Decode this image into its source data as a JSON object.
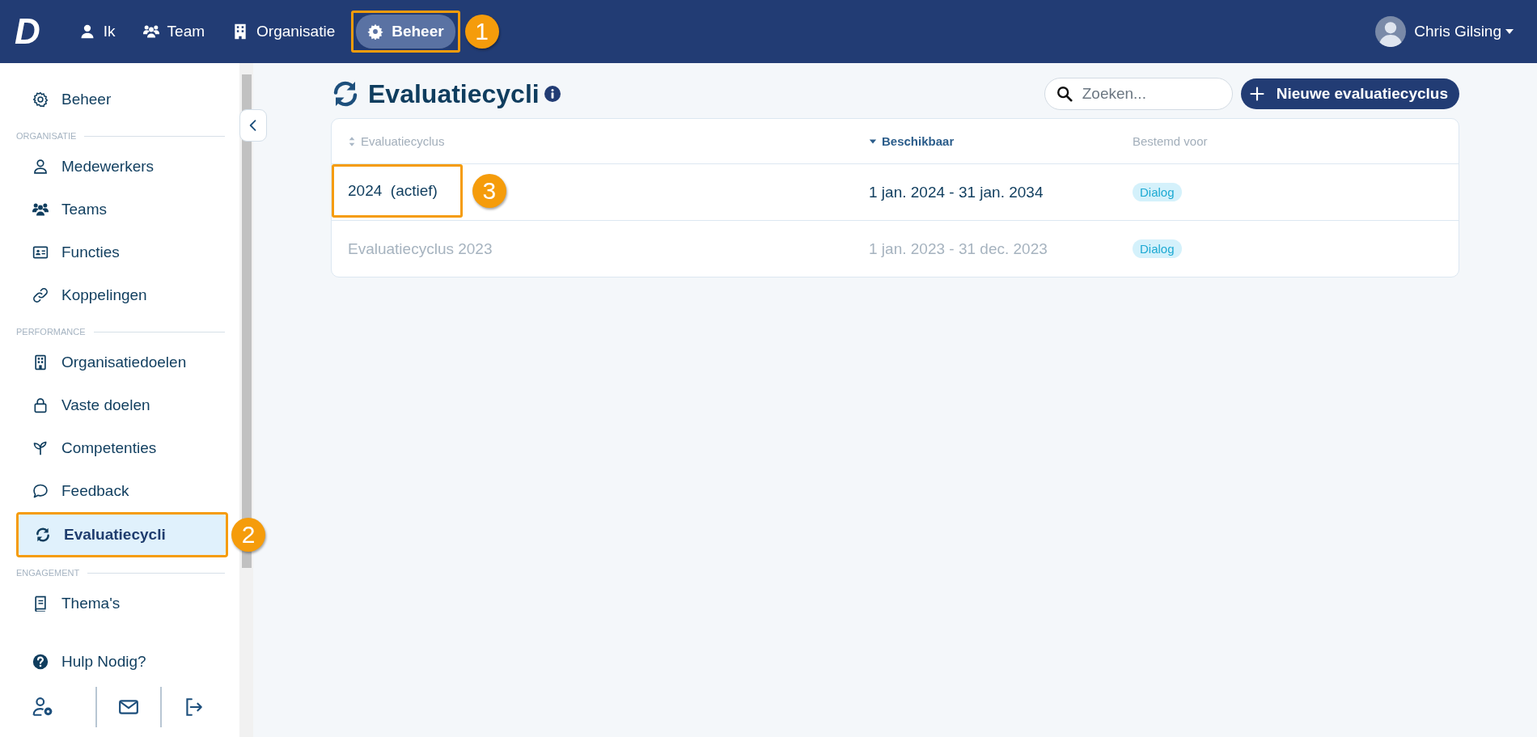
{
  "topbar": {
    "logo": "D",
    "nav": [
      {
        "label": "Ik",
        "kind": "person",
        "selected": false
      },
      {
        "label": "Team",
        "kind": "people",
        "selected": false
      },
      {
        "label": "Organisatie",
        "kind": "building",
        "selected": false
      },
      {
        "label": "Beheer",
        "kind": "gear",
        "selected": true,
        "callout": "1"
      }
    ],
    "user": {
      "name": "Chris Gilsing"
    }
  },
  "sidebar": {
    "sections": [
      {
        "items": [
          {
            "label": "Beheer",
            "kind": "settings",
            "selected": false
          }
        ]
      },
      {
        "heading": "ORGANISATIE",
        "items": [
          {
            "label": "Medewerkers",
            "kind": "employees",
            "selected": false
          },
          {
            "label": "Teams",
            "kind": "teams",
            "selected": false
          },
          {
            "label": "Functies",
            "kind": "functions",
            "selected": false
          },
          {
            "label": "Koppelingen",
            "kind": "links",
            "selected": false
          }
        ]
      },
      {
        "heading": "PERFORMANCE",
        "items": [
          {
            "label": "Organisatiedoelen",
            "kind": "goals",
            "selected": false
          },
          {
            "label": "Vaste doelen",
            "kind": "fixed",
            "selected": false
          },
          {
            "label": "Competenties",
            "kind": "competencies",
            "selected": false
          },
          {
            "label": "Feedback",
            "kind": "feedback",
            "selected": false
          },
          {
            "label": "Evaluatiecycli",
            "kind": "cycles",
            "selected": true,
            "callout": "2"
          }
        ]
      },
      {
        "heading": "ENGAGEMENT",
        "items": [
          {
            "label": "Thema's",
            "kind": "themes",
            "selected": false
          }
        ]
      }
    ],
    "help": {
      "label": "Hulp Nodig?"
    },
    "footer_actions": [
      {
        "kind": "account"
      },
      {
        "kind": "mail"
      },
      {
        "kind": "logout"
      }
    ]
  },
  "page": {
    "title": "Evaluatiecycli",
    "search": {
      "placeholder": "Zoeken..."
    },
    "new_button": "Nieuwe evaluatiecyclus"
  },
  "table": {
    "columns": [
      {
        "label": "Evaluatiecyclus",
        "sortable": true,
        "sorted": false
      },
      {
        "label": "Beschikbaar",
        "sortable": true,
        "sorted": true
      },
      {
        "label": "Bestemd voor",
        "sortable": false,
        "sorted": false
      }
    ],
    "rows": [
      {
        "cells": [
          "2024  (actief)",
          "1 jan. 2024 - 31 jan. 2034"
        ],
        "tag": "Dialog",
        "dimmed": false,
        "callout": "3"
      },
      {
        "cells": [
          "Evaluatiecyclus 2023",
          "1 jan. 2023 - 31 dec. 2023"
        ],
        "tag": "Dialog",
        "dimmed": true
      }
    ]
  }
}
